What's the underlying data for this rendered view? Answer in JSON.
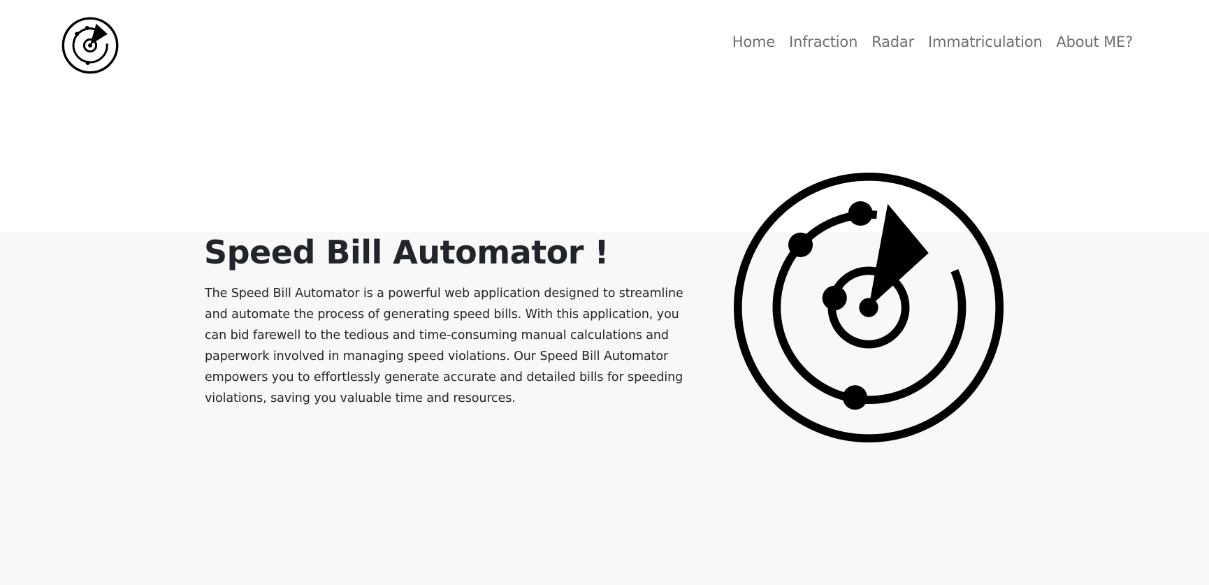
{
  "nav": {
    "logo_icon": "radar-icon",
    "links": [
      {
        "label": "Home"
      },
      {
        "label": "Infraction"
      },
      {
        "label": "Radar"
      },
      {
        "label": "Immatriculation"
      },
      {
        "label": "About ME?"
      }
    ]
  },
  "hero": {
    "title": "Speed Bill Automator !",
    "description": "The Speed Bill Automator is a powerful web application designed to streamline and automate the process of generating speed bills. With this application, you can bid farewell to the tedious and time-consuming manual calculations and paperwork involved in managing speed violations. Our Speed Bill Automator empowers you to effortlessly generate accurate and detailed bills for speeding violations, saving you valuable time and resources.",
    "image_icon": "radar-icon"
  },
  "colors": {
    "nav_text": "#6c6f73",
    "body_text": "#212529",
    "hero_background": "#f8f8f8"
  }
}
